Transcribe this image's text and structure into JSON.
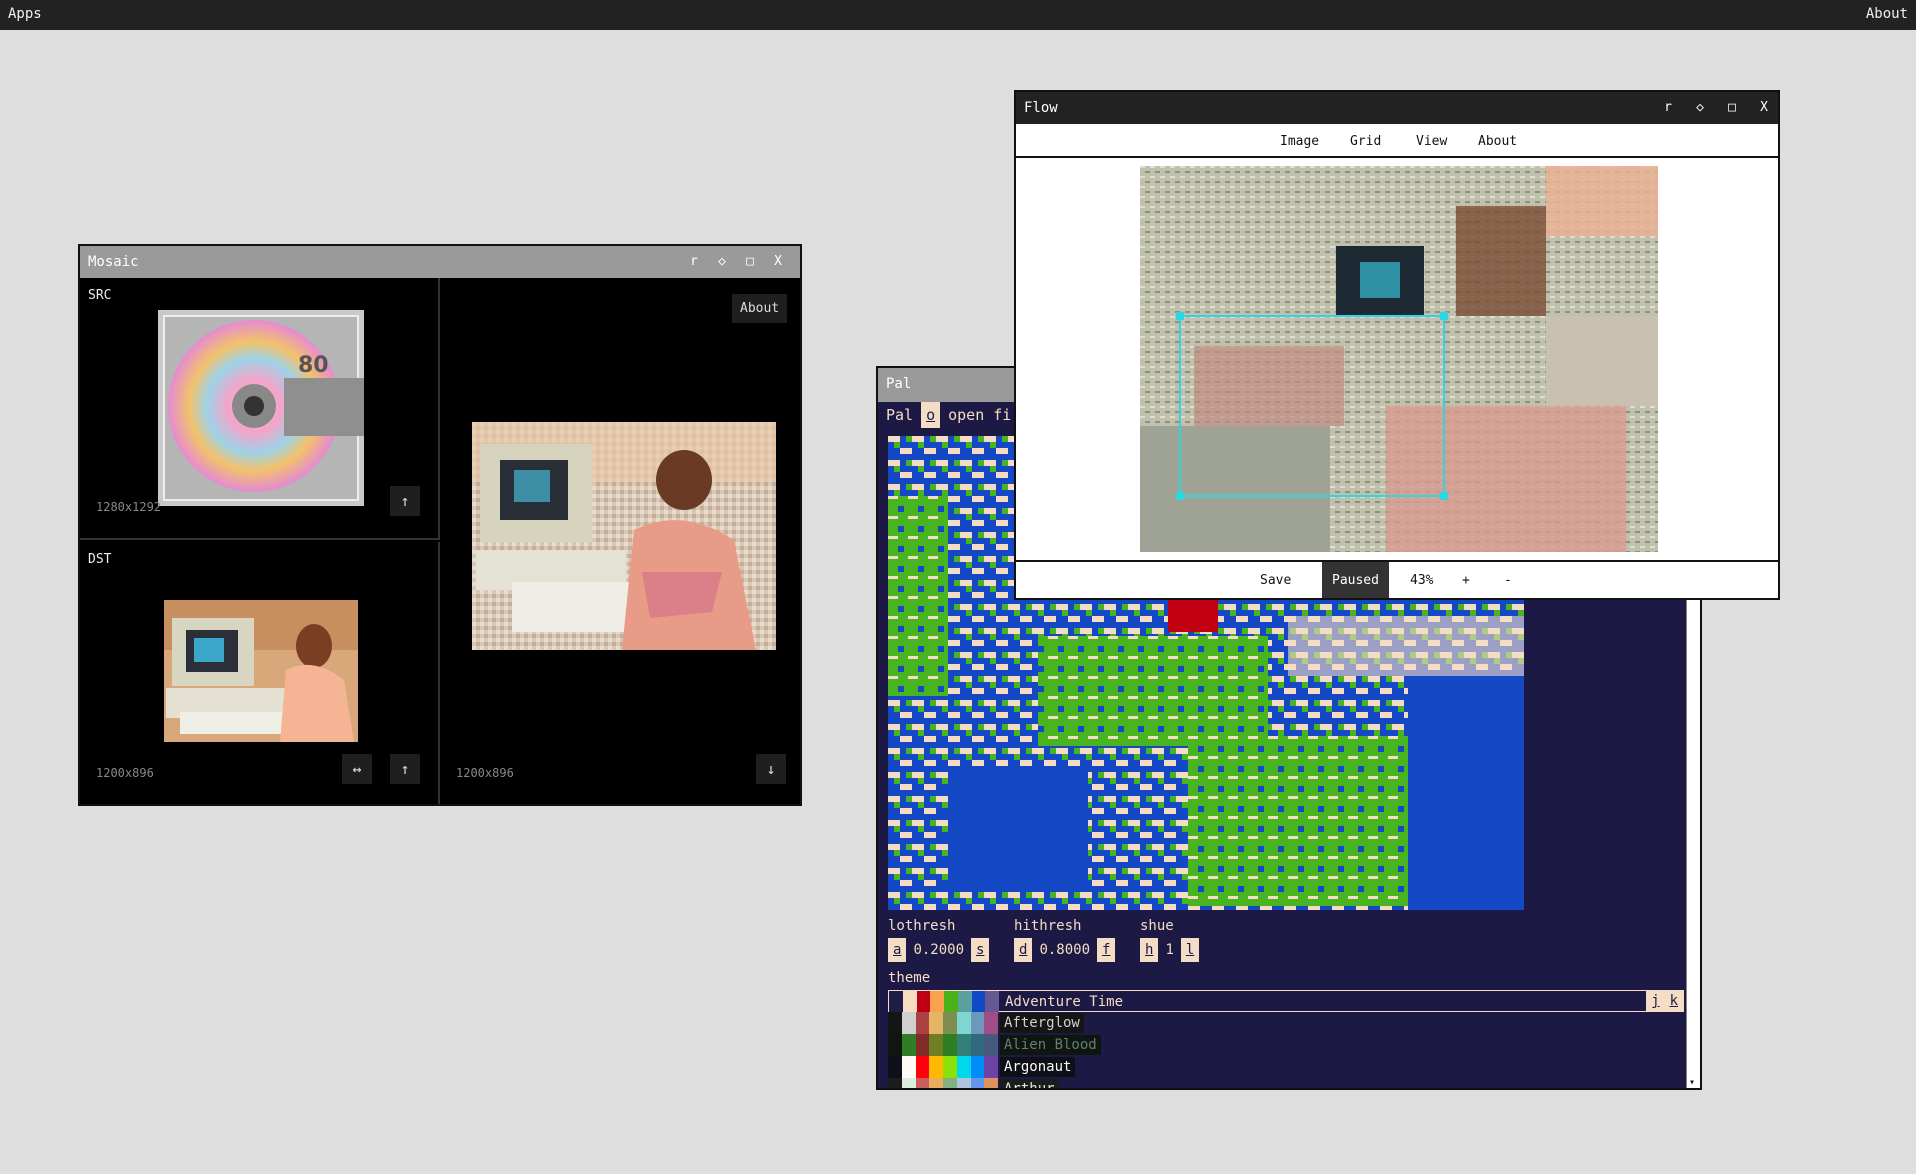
{
  "topbar": {
    "apps": "Apps",
    "about": "About"
  },
  "mosaic": {
    "title": "Mosaic",
    "win_buttons": [
      "r",
      "◇",
      "□",
      "X"
    ],
    "src_label": "SRC",
    "src_dims": "1280x1292",
    "dst_label": "DST",
    "dst_dims": "1200x896",
    "out_dims": "1200x896",
    "about_button": "About",
    "icons": {
      "upload": "↑",
      "swap": "↔",
      "download": "↓"
    }
  },
  "pal": {
    "title": "Pal",
    "tabs": {
      "pal": "Pal",
      "open_key": "o",
      "open": "open fi"
    },
    "lothresh": {
      "label": "lothresh",
      "dec_key": "a",
      "value": "0.2000",
      "inc_key": "s"
    },
    "hithresh": {
      "label": "hithresh",
      "dec_key": "d",
      "value": "0.8000",
      "inc_key": "f"
    },
    "shue": {
      "label": "shue",
      "dec_key": "h",
      "value": "1",
      "inc_key": "l"
    },
    "theme_label": "theme",
    "theme_nav": {
      "prev": "j",
      "next": "k"
    },
    "themes": [
      {
        "name": "Adventure Time",
        "colors": [
          "#1f1d45",
          "#f8dcc0",
          "#bd0013",
          "#f8a24f",
          "#4ab118",
          "#5aa0a0",
          "#0f49c6",
          "#665993"
        ]
      },
      {
        "name": "Afterglow",
        "colors": [
          "#151515",
          "#d0d0d0",
          "#ac4142",
          "#e5b567",
          "#7e8e50",
          "#7dd6cf",
          "#6c99bb",
          "#9f4e85"
        ]
      },
      {
        "name": "Alien Blood",
        "colors": [
          "#0f1610",
          "#2f7e25",
          "#7f2b27",
          "#717f24",
          "#2f7e25",
          "#327f77",
          "#2f6a7f",
          "#47587f"
        ]
      },
      {
        "name": "Argonaut",
        "colors": [
          "#0e1019",
          "#fffaf4",
          "#ff000f",
          "#ffb900",
          "#8ce10b",
          "#00d8eb",
          "#008df8",
          "#6d43a6"
        ]
      },
      {
        "name": "Arthur",
        "colors": [
          "#1c1c1c",
          "#ddeedd",
          "#cd5c5c",
          "#e8ae5b",
          "#86af80",
          "#b0c4de",
          "#6495ed",
          "#de935f"
        ]
      }
    ],
    "scroll_icon": "▾"
  },
  "flow": {
    "title": "Flow",
    "win_buttons": [
      "r",
      "◇",
      "□",
      "X"
    ],
    "menu": [
      "Image",
      "Grid",
      "View",
      "About"
    ],
    "footer": {
      "save": "Save",
      "state": "Paused",
      "zoom": "43%",
      "plus": "+",
      "minus": "-"
    },
    "selection_color": "#2fd6e0"
  }
}
